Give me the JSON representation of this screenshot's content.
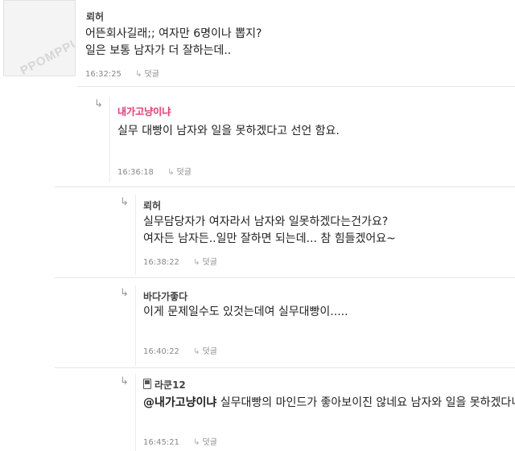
{
  "comments": [
    {
      "author": "뢰허",
      "lines": [
        "어뜬회사길래;; 여자만 6명이나 뽑지?",
        "일은 보통 남자가 더 잘하는데.."
      ],
      "time": "16:32:25",
      "reply_label": "덧글",
      "avatar_text": "PPOMPPU"
    },
    {
      "author": "내가고냥이냐",
      "lines": [
        "실무 대빵이 남자와 일을 못하겠다고 선언 함요."
      ],
      "time": "16:36:18",
      "reply_label": "덧글",
      "author_color": "#e8386f"
    },
    {
      "author": "뢰허",
      "lines": [
        "실무담당자가 여자라서 남자와 일못하겠다는건가요?",
        "여자든 남자든..일만 잘하면 되는데... 참 힘들겠어요~"
      ],
      "time": "16:38:22",
      "reply_label": "덧글"
    },
    {
      "author": "바다가좋다",
      "lines": [
        "이게 문제일수도 있것는데여 실무대빵이....."
      ],
      "time": "16:40:22",
      "reply_label": "덧글"
    },
    {
      "author": "라쿤12",
      "mention": "@내가고냥이냐",
      "lines": [
        " 실무대빵의 마인드가 좋아보이진 않네요 남자와 일을 못하겠다니..."
      ],
      "time": "16:45:21",
      "reply_label": "덧글",
      "author_icon": "phone-icon"
    }
  ]
}
